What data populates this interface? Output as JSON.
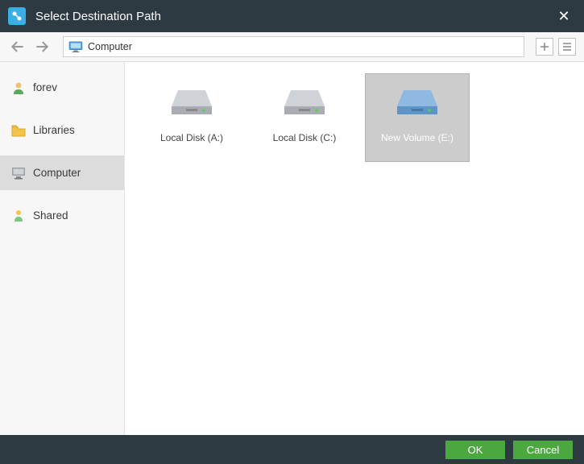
{
  "window": {
    "title": "Select Destination Path"
  },
  "path": {
    "label": "Computer"
  },
  "sidebar": {
    "items": [
      {
        "label": "forev",
        "type": "user"
      },
      {
        "label": "Libraries",
        "type": "libraries"
      },
      {
        "label": "Computer",
        "type": "computer",
        "selected": true
      },
      {
        "label": "Shared",
        "type": "shared"
      }
    ]
  },
  "drives": [
    {
      "label": "Local Disk (A:)",
      "selected": false,
      "color": "gray"
    },
    {
      "label": "Local Disk (C:)",
      "selected": false,
      "color": "gray"
    },
    {
      "label": "New Volume (E:)",
      "selected": true,
      "color": "blue"
    }
  ],
  "buttons": {
    "ok": "OK",
    "cancel": "Cancel"
  }
}
